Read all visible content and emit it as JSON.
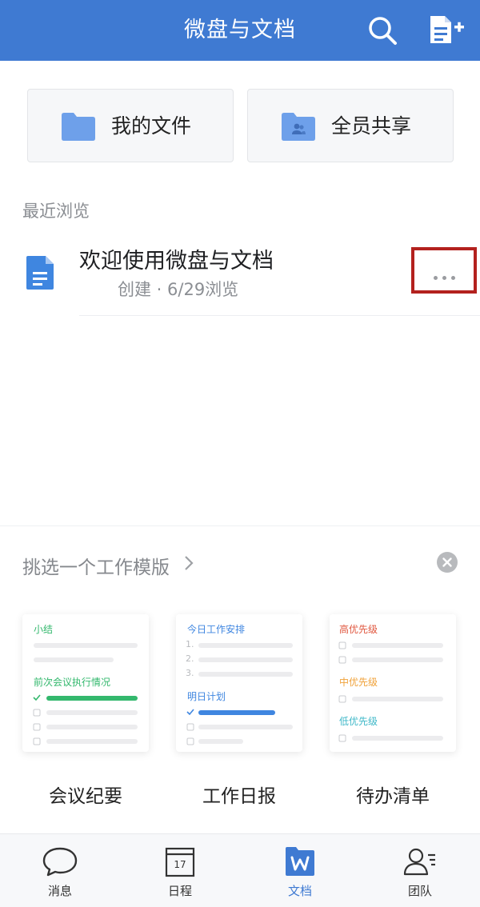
{
  "header": {
    "title": "微盘与文档",
    "bg_color": "#3f7ad2",
    "search_icon": "search-icon",
    "new_doc_icon": "new-document-icon"
  },
  "quick": {
    "mine_label": "我的文件",
    "shared_label": "全员共享"
  },
  "recent": {
    "section_title": "最近浏览",
    "items": [
      {
        "title": "欢迎使用微盘与文档",
        "meta": "创建 · 6/29浏览",
        "icon": "document-icon"
      }
    ]
  },
  "templates": {
    "heading": "挑选一个工作模版",
    "cards": [
      {
        "name": "会议纪要",
        "preview_title": "小结",
        "preview_section": "前次会议执行情况",
        "accent": "#33b86d"
      },
      {
        "name": "工作日报",
        "preview_title": "今日工作安排",
        "preview_section": "明日计划",
        "accent": "#3f86e0",
        "preview_numbers": [
          "1.",
          "2.",
          "3."
        ]
      },
      {
        "name": "待办清单",
        "preview_high": "高优先级",
        "preview_mid": "中优先级",
        "preview_low": "低优先级",
        "high_color": "#e0573f",
        "mid_color": "#f0a23a",
        "low_color": "#3fb8c8"
      }
    ]
  },
  "tabs": [
    {
      "label": "消息",
      "icon": "message-icon"
    },
    {
      "label": "日程",
      "icon": "calendar-icon",
      "calendar_day": "17"
    },
    {
      "label": "文档",
      "icon": "document-w-icon",
      "active": true
    },
    {
      "label": "团队",
      "icon": "team-icon"
    }
  ],
  "colors": {
    "accent": "#3f7ad2",
    "folder": "#6ea0ea",
    "highlight_box": "#b3211e"
  }
}
